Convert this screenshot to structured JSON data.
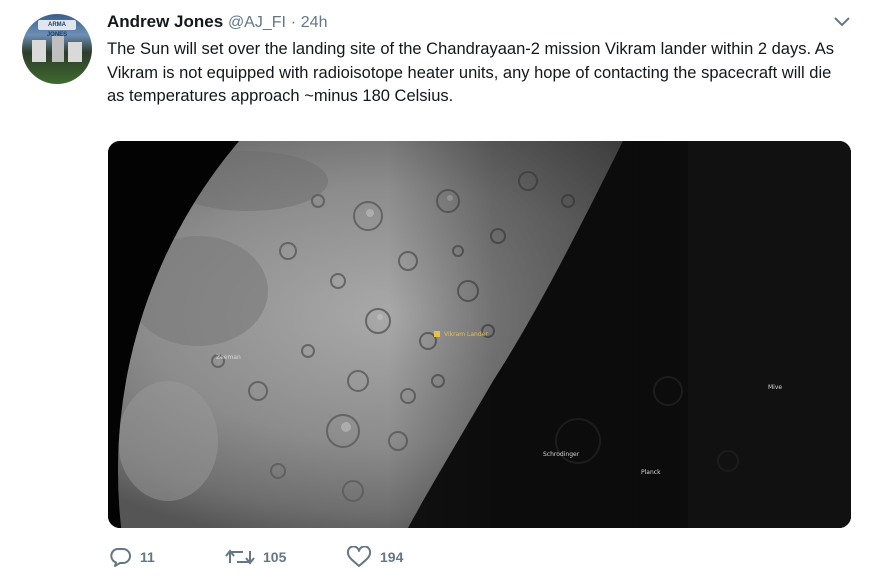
{
  "tweet": {
    "author_name": "Andrew Jones",
    "handle": "@AJ_FI",
    "separator": "·",
    "time": "24h",
    "avatar_sign": "ARMA JONES",
    "text": "The Sun will set over the landing site of the Chandrayaan-2 mission Vikram lander within 2 days. As Vikram is not equipped with radioisotope heater units, any hope of contacting the spacecraft will die as temperatures approach ~minus 180 Celsius.",
    "image_labels": {
      "site": "Vikram Lander",
      "crater_a": "Zeeman",
      "crater_b": "Mive",
      "crater_c": "Schrodinger",
      "crater_d": "Planck"
    }
  },
  "actions": {
    "replies": "11",
    "retweets": "105",
    "likes": "194"
  },
  "icons": {
    "caret": "chevron-down-icon",
    "reply": "reply-icon",
    "retweet": "retweet-icon",
    "like": "heart-icon"
  },
  "colors": {
    "text": "#14171a",
    "secondary": "#657786",
    "site_marker": "#e6c04a"
  }
}
